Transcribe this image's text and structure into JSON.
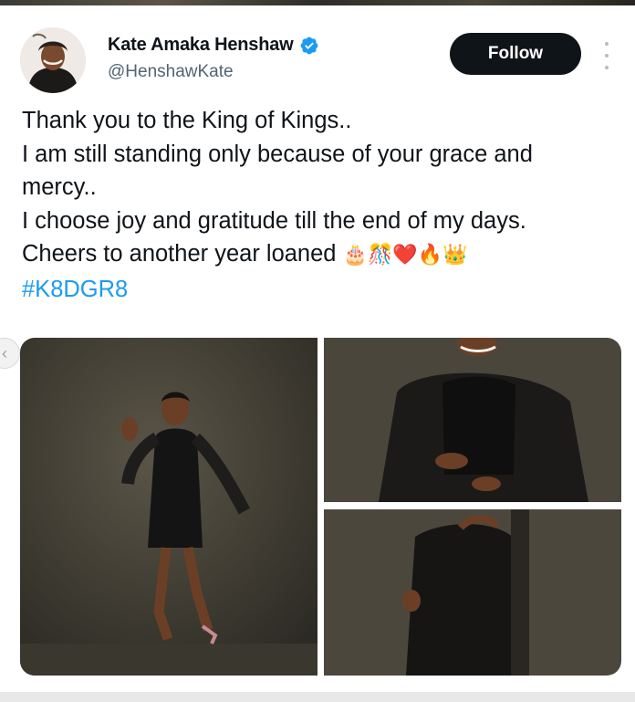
{
  "author": {
    "name": "Kate Amaka Henshaw",
    "handle": "@HenshawKate",
    "verified": true
  },
  "actions": {
    "follow_label": "Follow"
  },
  "tweet": {
    "lines": [
      "Thank you to the King of Kings..",
      "I am still standing only because of your grace and",
      "mercy..",
      "I choose joy and gratitude till the end of my days.",
      "Cheers to another year loaned"
    ],
    "emojis": "🎂🎊❤️🔥👑",
    "hashtag": "#K8DGR8"
  },
  "colors": {
    "accent": "#1d9bf0",
    "text": "#0f1419",
    "muted": "#536471",
    "button": "#0f1419"
  },
  "media": [
    {
      "name": "photo-full-length-pose"
    },
    {
      "name": "photo-upper-body"
    },
    {
      "name": "photo-side-view"
    }
  ]
}
